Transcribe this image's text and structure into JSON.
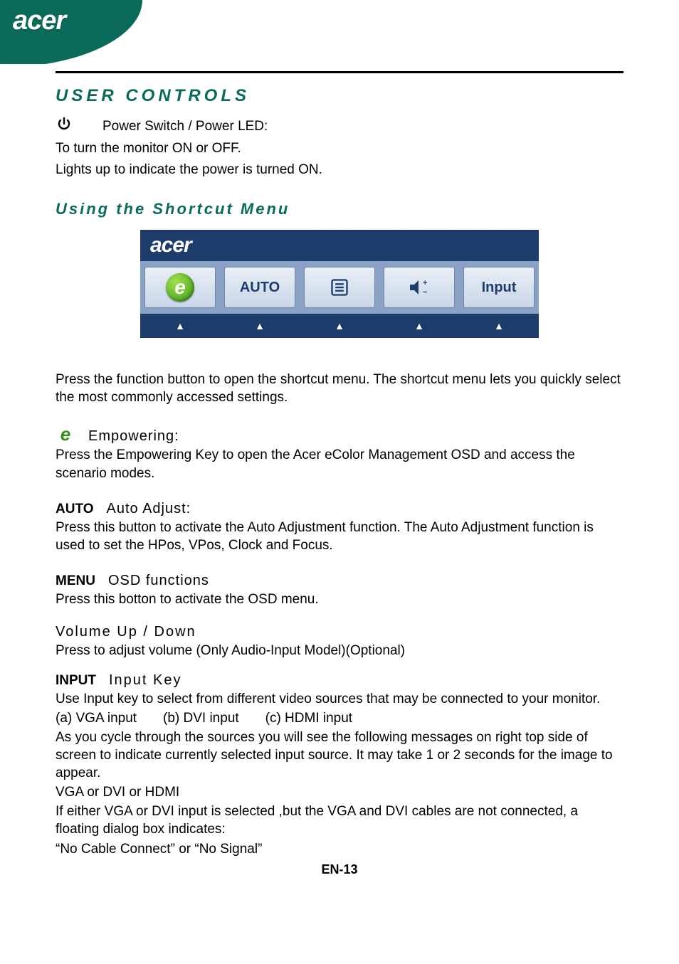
{
  "brand": "acer",
  "section_title": "USER CONTROLS",
  "power": {
    "label": "Power Switch / Power LED:",
    "line1": "To turn the monitor ON or OFF.",
    "line2": "Lights up to indicate the power is turned ON."
  },
  "shortcut_heading": "Using   the  Shortcut  Menu",
  "menu": {
    "brand": "acer",
    "buttons": {
      "e": "e",
      "auto": "AUTO",
      "input": "Input"
    }
  },
  "shortcut_intro": "Press the function button to open the shortcut menu. The shortcut menu lets you quickly select the most commonly accessed settings.",
  "empowering": {
    "icon": "e",
    "title": "Empowering:",
    "body": "Press the Empowering Key to open the Acer eColor Management OSD and access the scenario modes."
  },
  "auto": {
    "label": "AUTO",
    "title": "Auto Adjust:",
    "body": "Press this button to activate the Auto Adjustment function. The Auto Adjustment function is used to set the HPos, VPos, Clock and Focus."
  },
  "menu_fn": {
    "label": "MENU",
    "title": "OSD functions",
    "body": "Press this botton to activate the OSD menu."
  },
  "volume": {
    "title": "Volume  Up  /  Down",
    "body": " Press to adjust volume (Only Audio-Input Model)(Optional)"
  },
  "input": {
    "label": "INPUT",
    "title": "Input Key",
    "l1": "Use Input key to select from different video sources that may be connected to your monitor.",
    "l2": "(a) VGA input       (b) DVI input       (c) HDMI input",
    "l3": "As you cycle through the sources you will see the following messages on right top side of screen to indicate currently selected input source. It may take 1 or 2 seconds for the image to appear.",
    "l4": "VGA   or  DVI  or  HDMI",
    "l5": "If either VGA or DVI input is selected ,but the VGA and DVI cables are not connected, a floating dialog box indicates:",
    "l6": "“No Cable Connect” or “No Signal”"
  },
  "page_number": "EN-13"
}
